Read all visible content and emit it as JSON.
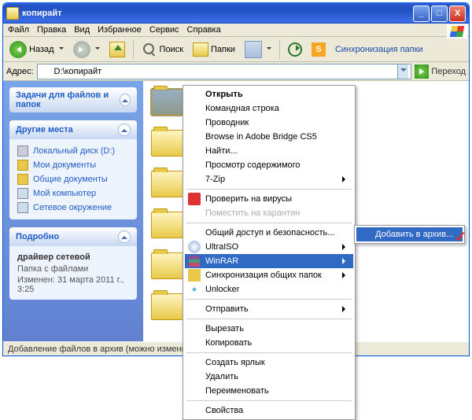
{
  "window": {
    "title": "копирайт"
  },
  "titlebuttons": {
    "min": "_",
    "max": "□",
    "close": "X"
  },
  "menubar": {
    "file": "Файл",
    "edit": "Правка",
    "view": "Вид",
    "favorites": "Избранное",
    "tools": "Сервис",
    "help": "Справка"
  },
  "toolbar": {
    "back": "Назад",
    "search": "Поиск",
    "folders": "Папки",
    "sync": "Синхронизация папки"
  },
  "addressbar": {
    "label": "Адрес:",
    "path": "D:\\копирайт",
    "go": "Переход"
  },
  "sidebar": {
    "panel1": {
      "title": "Задачи для файлов и папок"
    },
    "panel2": {
      "title": "Другие места",
      "items": [
        "Локальный диск (D:)",
        "Мои документы",
        "Общие документы",
        "Мой компьютер",
        "Сетевое окружение"
      ]
    },
    "panel3": {
      "title": "Подробно",
      "name": "драйвер сетевой",
      "type": "Папка с файлами",
      "modified": "Изменен: 31 марта 2011 г., 3:25"
    }
  },
  "statusbar": {
    "text": "Добавление файлов в архив (можно изменить дополнител"
  },
  "contextmenu": {
    "items": {
      "open": "Открыть",
      "cmdline": "Командная строка",
      "explorer": "Проводник",
      "bridge": "Browse in Adobe Bridge CS5",
      "find": "Найти...",
      "viewcontent": "Просмотр содержимого",
      "sevenzip": "7-Zip",
      "scan": "Проверить на вирусы",
      "quarantine": "Поместить на карантин",
      "sharing": "Общий доступ и безопасность...",
      "ultraiso": "UltraISO",
      "winrar": "WinRAR",
      "syncfolders": "Синхронизация общих папок",
      "unlocker": "Unlocker",
      "sendto": "Отправить",
      "cut": "Вырезать",
      "copy": "Копировать",
      "shortcut": "Создать ярлык",
      "delete": "Удалить",
      "rename": "Переименовать",
      "properties": "Свойства"
    }
  },
  "submenu": {
    "addtoarchive": "Добавить в архив..."
  }
}
